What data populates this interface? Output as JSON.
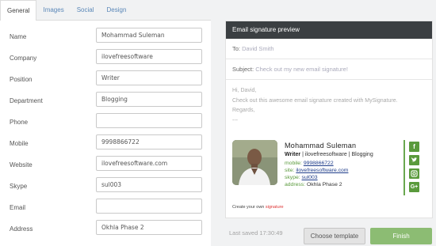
{
  "tabs": [
    "General",
    "Images",
    "Social",
    "Design"
  ],
  "form": {
    "fields": [
      {
        "label": "Name",
        "value": "Mohammad Suleman"
      },
      {
        "label": "Company",
        "value": "ilovefreesoftware"
      },
      {
        "label": "Position",
        "value": "Writer"
      },
      {
        "label": "Department",
        "value": "Blogging"
      },
      {
        "label": "Phone",
        "value": ""
      },
      {
        "label": "Mobile",
        "value": "9998866722"
      },
      {
        "label": "Website",
        "value": "ilovefreesoftware.com"
      },
      {
        "label": "Skype",
        "value": "sul003"
      },
      {
        "label": "Email",
        "value": ""
      },
      {
        "label": "Address",
        "value": "Okhla Phase 2"
      }
    ]
  },
  "preview": {
    "header": "Email signature preview",
    "to_label": "To:",
    "to_value": "David Smith",
    "subject_label": "Subject:",
    "subject_value": "Check out my new email signature!",
    "body": [
      "Hi, David,",
      "Check out this awesome email signature created with MySignature.",
      "Regards,",
      "---"
    ],
    "signature": {
      "name": "Mohammad Suleman",
      "position": "Writer",
      "company": "ilovefreesoftware",
      "department": "Blogging",
      "mobile_label": "mobile:",
      "mobile": "9998866722",
      "site_label": "site:",
      "site": "ilovefreesoftware.com",
      "skype_label": "skype:",
      "skype": "sul003",
      "address_label": "address:",
      "address": "Okhla Phase 2",
      "accent_color": "#5a9a3c",
      "social_icons": [
        "facebook-icon",
        "twitter-icon",
        "instagram-icon",
        "google-plus-icon"
      ]
    },
    "create_own_prefix": "Create your own",
    "create_own_link": "signature"
  },
  "footer": {
    "last_saved": "Last saved 17:30:49",
    "choose_template": "Choose template",
    "finish": "Finish"
  }
}
